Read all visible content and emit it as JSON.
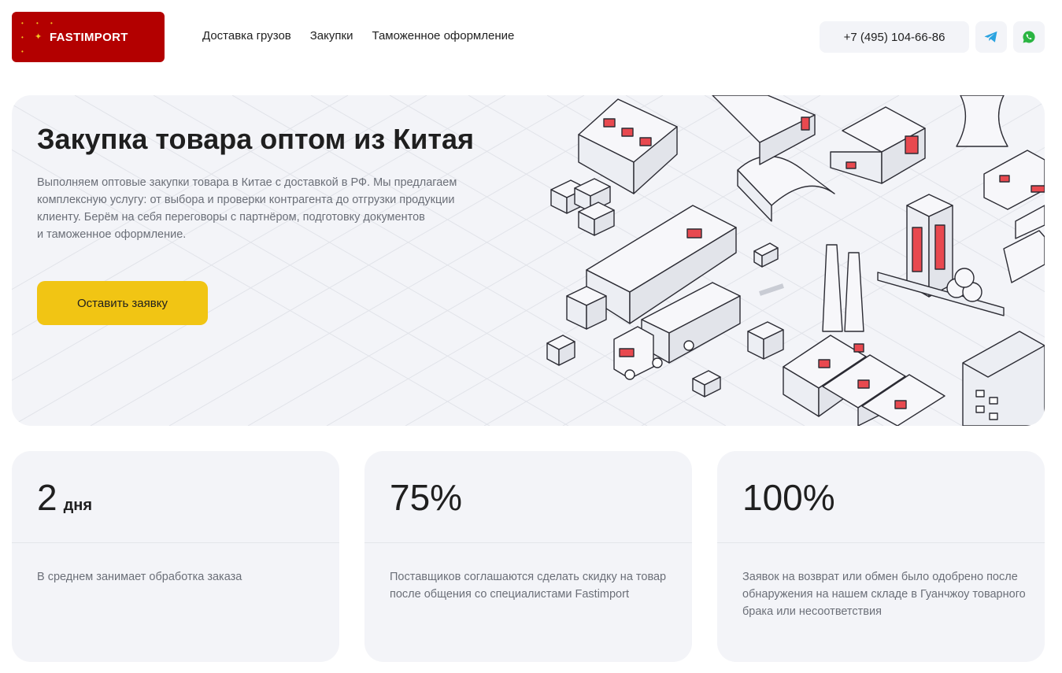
{
  "header": {
    "logo_text": "FASTIMPORT",
    "nav": [
      {
        "label": "Доставка грузов"
      },
      {
        "label": "Закупки"
      },
      {
        "label": "Таможенное оформление"
      }
    ],
    "phone": "+7 (495) 104-66-86",
    "icons": {
      "telegram": "telegram-icon",
      "whatsapp": "whatsapp-icon"
    }
  },
  "hero": {
    "title": "Закупка товара оптом из Китая",
    "text": "Выполняем оптовые закупки товара в Китае с доставкой в РФ. Мы предлагаем\nкомплексную услугу: от выбора и проверки контрагента до отгрузки продукции\nклиенту. Берём на себя переговоры с партнёром, подготовку документов\nи таможенное оформление.",
    "cta_label": "Оставить заявку"
  },
  "stats": [
    {
      "value": "2",
      "unit": "дня",
      "description": "В среднем занимает обработка заказа"
    },
    {
      "value": "75%",
      "unit": "",
      "description": "Поставщиков соглашаются сделать скидку на товар после общения со специалистами Fastimport"
    },
    {
      "value": "100%",
      "unit": "",
      "description": "Заявок на возврат или обмен было одобрено после обнаружения на нашем складе в Гуанчжоу товарного брака или несоответствия"
    }
  ],
  "colors": {
    "brand_red": "#b30000",
    "accent_yellow": "#f1c514",
    "card_bg": "#f3f4f8",
    "telegram": "#2aa3e0",
    "whatsapp": "#2bb542",
    "illustration_red": "#e8494f"
  }
}
